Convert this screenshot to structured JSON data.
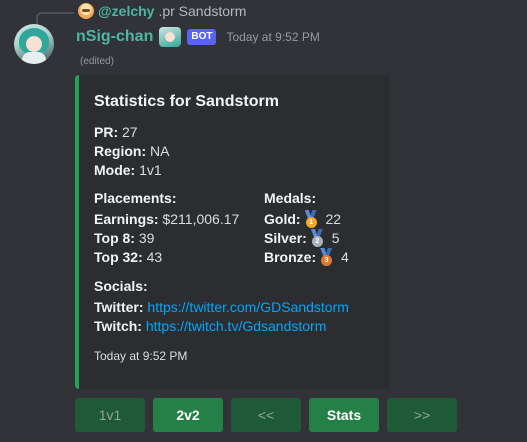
{
  "reply": {
    "user": "@zelchy",
    "text": ".pr Sandstorm"
  },
  "message": {
    "username": "nSig-chan",
    "bot_tag": "BOT",
    "timestamp": "Today at 9:52 PM",
    "edited": "(edited)"
  },
  "embed": {
    "accent_color": "#23a559",
    "title": "Statistics for Sandstorm",
    "pr_label": "PR:",
    "pr_value": "27",
    "region_label": "Region:",
    "region_value": "NA",
    "mode_label": "Mode:",
    "mode_value": "1v1",
    "placements_title": "Placements:",
    "earnings_label": "Earnings:",
    "earnings_value": "$211,006.17",
    "top8_label": "Top 8:",
    "top8_value": "39",
    "top32_label": "Top 32:",
    "top32_value": "43",
    "medals_title": "Medals:",
    "gold_label": "Gold:",
    "gold_value": "22",
    "silver_label": "Silver:",
    "silver_value": "5",
    "bronze_label": "Bronze:",
    "bronze_value": "4",
    "socials_title": "Socials:",
    "twitter_label": "Twitter:",
    "twitter_url": "https://twitter.com/GDSandstorm",
    "twitch_label": "Twitch:",
    "twitch_url": "https://twitch.tv/Gdsandstorm",
    "footer": "Today at 9:52 PM"
  },
  "buttons": [
    {
      "label": "1v1",
      "state": "disabled"
    },
    {
      "label": "2v2",
      "state": "enabled"
    },
    {
      "label": "<<",
      "state": "disabled"
    },
    {
      "label": "Stats",
      "state": "enabled"
    },
    {
      "label": ">>",
      "state": "disabled"
    }
  ],
  "icons": {
    "gold": "gold-medal-icon",
    "silver": "silver-medal-icon",
    "bronze": "bronze-medal-icon"
  }
}
